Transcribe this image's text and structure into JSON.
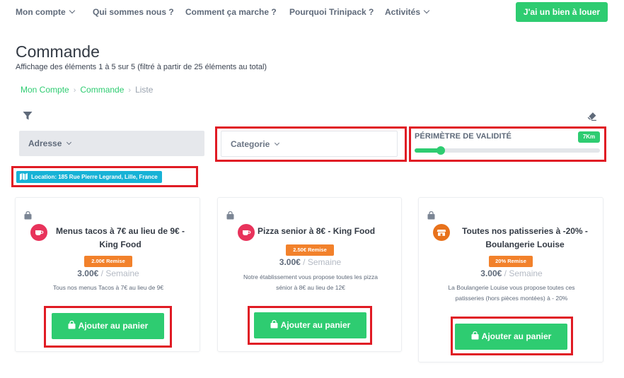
{
  "nav": {
    "items": [
      {
        "label": "Mon compte",
        "has_dropdown": true
      },
      {
        "label": "Qui sommes nous ?",
        "has_dropdown": false
      },
      {
        "label": "Comment ça marche ?",
        "has_dropdown": false
      },
      {
        "label": "Pourquoi Trinipack ?",
        "has_dropdown": false
      },
      {
        "label": "Activités",
        "has_dropdown": true
      }
    ],
    "cta_label": "J'ai un bien à louer"
  },
  "header": {
    "title": "Commande",
    "subtitle": "Affichage des éléments 1 à 5 sur 5 (filtré à partir de 25 éléments au total)"
  },
  "breadcrumb": [
    "Mon Compte",
    "Commande",
    "Liste"
  ],
  "filters": {
    "address_label": "Adresse",
    "category_label": "Categorie",
    "perimeter_label": "PÉRIMÈTRE DE VALIDITÉ",
    "perimeter_value": "7Km",
    "perimeter_fraction": 0.14,
    "location_badge": "Location: 185 Rue Pierre Legrand, Lille, France"
  },
  "products": [
    {
      "title": "Menus tacos à 7€ au lieu de 9€ - King Food",
      "discount": "2.00€ Remise",
      "price": "3.00€",
      "period": "/ Semaine",
      "description": "Tous nos menus Tacos à 7€ au lieu de 9€",
      "button_label": "Ajouter au panier",
      "icon": "coffee-cup-icon",
      "icon_color": "#e8335b"
    },
    {
      "title": "Pizza senior à 8€ - King Food",
      "discount": "2.50€ Remise",
      "price": "3.00€",
      "period": "/ Semaine",
      "description": "Notre établissement vous propose toutes les pizza sénior à 8€ au lieu de 12€",
      "button_label": "Ajouter au panier",
      "icon": "coffee-cup-icon",
      "icon_color": "#e8335b"
    },
    {
      "title": "Toutes nos patisseries à -20% - Boulangerie Louise",
      "discount": "20% Remise",
      "price": "3.00€",
      "period": "/ Semaine",
      "description": "La Boulangerie Louise vous propose toutes ces patisseries (hors pièces montées) à - 20%",
      "button_label": "Ajouter au panier",
      "icon": "store-icon",
      "icon_color": "#e8721c"
    }
  ],
  "colors": {
    "brand_green": "#2ecc71",
    "discount_orange": "#f2812b",
    "location_blue": "#17b2d6",
    "highlight_red": "#e01b24"
  }
}
